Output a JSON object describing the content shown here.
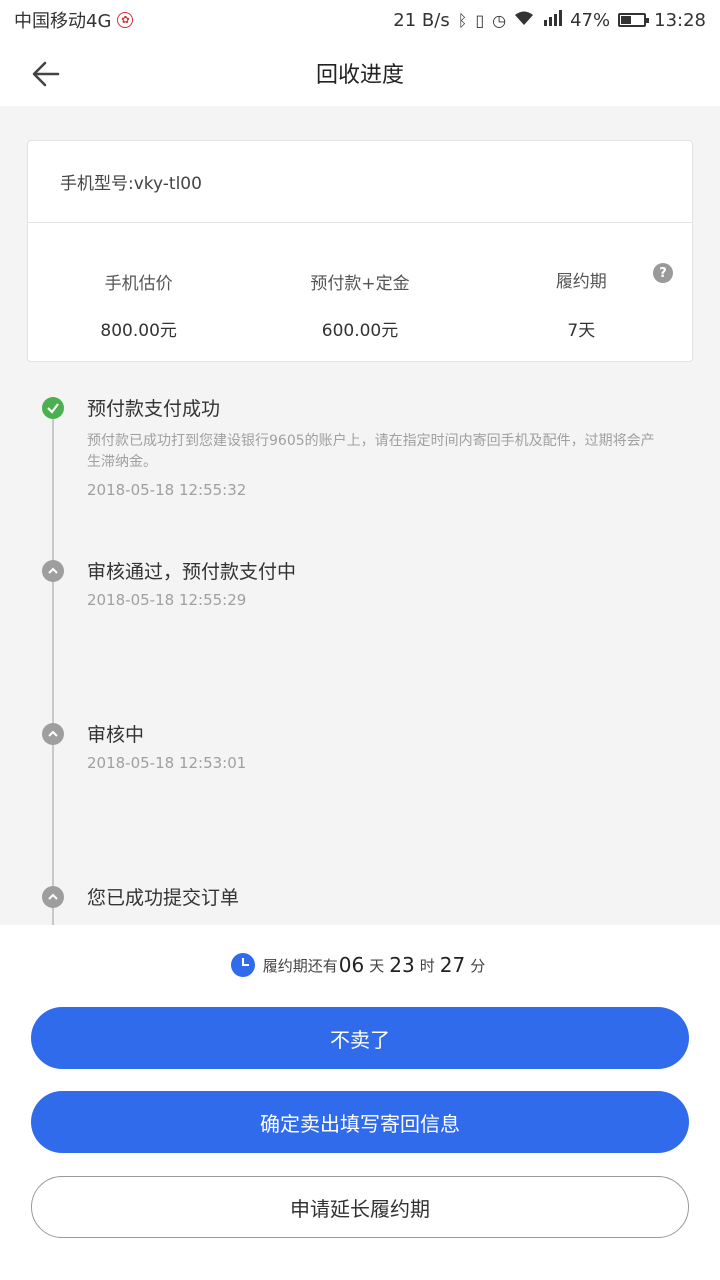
{
  "status_bar": {
    "carrier": "中国移动4G",
    "net_speed": "21 B/s",
    "network": "4G",
    "battery": "47%",
    "battery_level": 0.47,
    "time": "13:28"
  },
  "header": {
    "title": "回收进度"
  },
  "card": {
    "model": "手机型号:vky-tl00",
    "columns": [
      {
        "label": "手机估价",
        "value": "800.00元"
      },
      {
        "label": "预付款+定金",
        "value": "600.00元"
      },
      {
        "label": "履约期",
        "value": "7天"
      }
    ],
    "help_glyph": "?"
  },
  "timeline": [
    {
      "title": "预付款支付成功",
      "desc": "预付款已成功打到您建设银行9605的账户上，请在指定时间内寄回手机及配件，过期将会产生滞纳金。",
      "time": "2018-05-18 12:55:32",
      "status": "done"
    },
    {
      "title": "审核通过，预付款支付中",
      "time": "2018-05-18 12:55:29",
      "status": "pending"
    },
    {
      "title": "审核中",
      "time": "2018-05-18 12:53:01",
      "status": "pending"
    },
    {
      "title": "您已成功提交订单",
      "status": "pending"
    }
  ],
  "countdown": {
    "prefix": "履约期还有",
    "days": "06",
    "days_unit": "天",
    "hours": "23",
    "hours_unit": "时",
    "minutes": "27",
    "minutes_unit": "分"
  },
  "buttons": {
    "cancel": "不卖了",
    "confirm": "确定卖出填写寄回信息",
    "extend": "申请延长履约期"
  },
  "colors": {
    "accent": "#2f6bea",
    "success": "#4caf50",
    "inactive": "#9e9e9e"
  }
}
